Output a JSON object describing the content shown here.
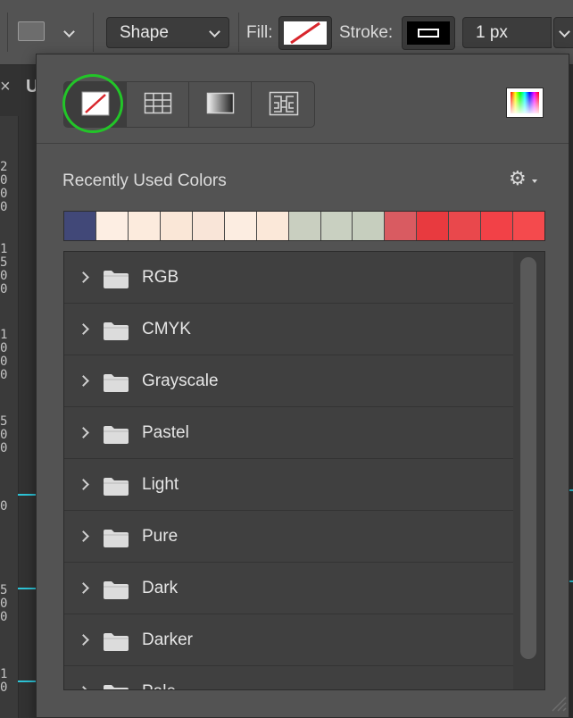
{
  "options_bar": {
    "mode_dropdown": "Shape",
    "fill_label": "Fill:",
    "stroke_label": "Stroke:",
    "stroke_width": "1 px"
  },
  "background": {
    "tab_close_glyph": "×",
    "tab_title_fragment": "U",
    "ruler_numbers": [
      {
        "text": "2\n0\n0\n0"
      },
      {
        "text": "1\n5\n0\n0"
      },
      {
        "text": "1\n0\n0\n0"
      },
      {
        "text": "5\n0\n0"
      },
      {
        "text": "0"
      },
      {
        "text": "5\n0\n0"
      },
      {
        "text": "1\n0"
      }
    ],
    "guide_color": "#2ec5d8"
  },
  "panel": {
    "fill_modes": [
      {
        "name": "no-color",
        "icon": "no-fill-icon"
      },
      {
        "name": "solid-color",
        "icon": "grid-icon"
      },
      {
        "name": "gradient",
        "icon": "gradient-icon"
      },
      {
        "name": "pattern",
        "icon": "pattern-icon"
      }
    ],
    "highlight_color": "#22c528",
    "recent_label": "Recently Used Colors",
    "settings_icon": "gear-icon",
    "recent_colors": [
      "#414878",
      "#fdeee3",
      "#fcebdd",
      "#fae7d7",
      "#f9e5d8",
      "#fcede1",
      "#fbe8d9",
      "#c9cfc0",
      "#c9d0c1",
      "#c6cebe",
      "#d95b61",
      "#e83a3f",
      "#e9484c",
      "#f24147",
      "#f44a4d"
    ],
    "groups": [
      {
        "label": "RGB"
      },
      {
        "label": "CMYK"
      },
      {
        "label": "Grayscale"
      },
      {
        "label": "Pastel"
      },
      {
        "label": "Light"
      },
      {
        "label": "Pure"
      },
      {
        "label": "Dark"
      },
      {
        "label": "Darker"
      },
      {
        "label": "Pale"
      }
    ]
  }
}
